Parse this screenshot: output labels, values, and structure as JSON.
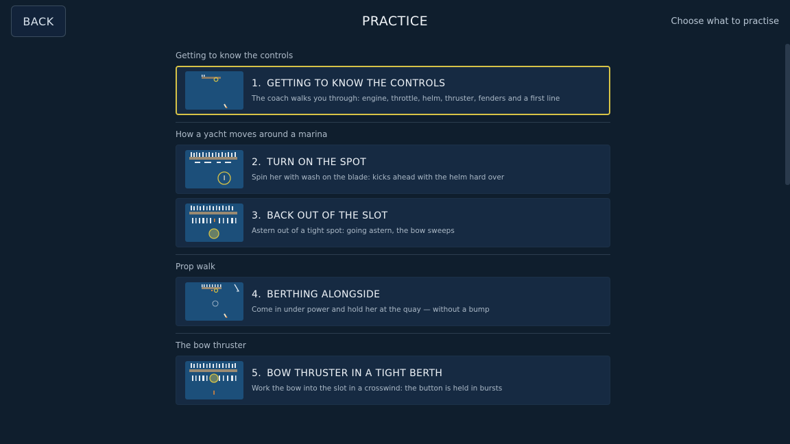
{
  "header": {
    "back_label": "BACK",
    "title": "PRACTICE",
    "subtitle": "Choose what to practise"
  },
  "sections": [
    {
      "title": "Getting to know the controls",
      "items": [
        {
          "num": "1.",
          "title": "GETTING TO KNOW THE CONTROLS",
          "desc": "The coach walks you through: engine, throttle, helm, thruster, fenders and a first line",
          "selected": true
        }
      ]
    },
    {
      "title": "How a yacht moves around a marina",
      "items": [
        {
          "num": "2.",
          "title": "TURN ON THE SPOT",
          "desc": "Spin her with wash on the blade: kicks ahead with the helm hard over"
        },
        {
          "num": "3.",
          "title": "BACK OUT OF THE SLOT",
          "desc": "Astern out of a tight spot: going astern, the bow sweeps"
        }
      ]
    },
    {
      "title": "Prop walk",
      "items": [
        {
          "num": "4.",
          "title": "BERTHING ALONGSIDE",
          "desc": "Come in under power and hold her at the quay — without a bump"
        }
      ]
    },
    {
      "title": "The bow thruster",
      "items": [
        {
          "num": "5.",
          "title": "BOW THRUSTER IN A TIGHT BERTH",
          "desc": "Work the bow into the slot in a crosswind: the button is held in bursts"
        }
      ]
    }
  ],
  "colors": {
    "background": "#0f1e2d",
    "card": "#162a42",
    "selected_border": "#d8c447",
    "water": "#1c4f7a"
  }
}
